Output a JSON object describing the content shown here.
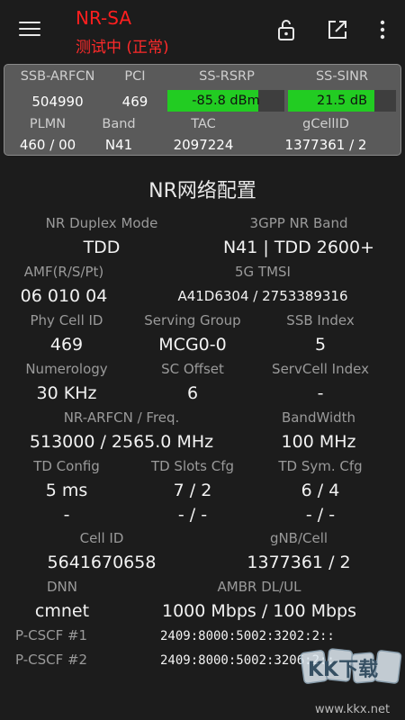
{
  "header": {
    "title": "NR-SA",
    "subtitle": "测试中 (正常)"
  },
  "panel": {
    "row1_labels": [
      "SSB-ARFCN",
      "PCI",
      "SS-RSRP",
      "SS-SINR"
    ],
    "ssb_arfcn": "504990",
    "pci": "469",
    "rsrp": {
      "text": "-85.8 dBm",
      "fill_fraction": 0.78,
      "color": "#22cc22"
    },
    "sinr": {
      "text": "21.5 dB",
      "fill_fraction": 0.8,
      "color": "#22cc22"
    },
    "row2_labels": [
      "PLMN",
      "Band",
      "TAC",
      "gCellID"
    ],
    "plmn": "460 / 00",
    "band": "N41",
    "tac": "2097224",
    "gcellid": "1377361 / 2"
  },
  "section_title": "NR网络配置",
  "config": {
    "duplex_label": "NR Duplex Mode",
    "duplex_value": "TDD",
    "band_label": "3GPP NR Band",
    "band_value": "N41 | TDD 2600+",
    "amf_label": "AMF(R/S/Pt)",
    "amf_value": "06 010 04",
    "tmsi_label": "5G TMSI",
    "tmsi_value": "A41D6304 / 2753389316",
    "phy_cell_label": "Phy Cell ID",
    "phy_cell_value": "469",
    "serving_group_label": "Serving Group",
    "serving_group_value": "MCG0-0",
    "ssb_index_label": "SSB Index",
    "ssb_index_value": "5",
    "numerology_label": "Numerology",
    "numerology_value": "30 KHz",
    "sc_offset_label": "SC Offset",
    "sc_offset_value": "6",
    "servcell_index_label": "ServCell Index",
    "servcell_index_value": "-",
    "arfcn_label": "NR-ARFCN / Freq.",
    "arfcn_value": "513000 / 2565.0 MHz",
    "bandwidth_label": "BandWidth",
    "bandwidth_value": "100 MHz",
    "td_config_label": "TD Config",
    "td_config_value": "5 ms",
    "td_config_value2": "-",
    "td_slots_label": "TD Slots Cfg",
    "td_slots_value": "7 / 2",
    "td_slots_value2": "- / -",
    "td_sym_label": "TD Sym. Cfg",
    "td_sym_value": "6 / 4",
    "td_sym_value2": "- / -",
    "cell_id_label": "Cell ID",
    "cell_id_value": "5641670658",
    "gnb_label": "gNB/Cell",
    "gnb_value": "1377361 / 2",
    "dnn_label": "DNN",
    "dnn_value": "cmnet",
    "ambr_label": "AMBR DL/UL",
    "ambr_value": "1000 Mbps / 100 Mbps",
    "pcscf1_label": "P-CSCF #1",
    "pcscf1_value": "2409:8000:5002:3202:2::",
    "pcscf2_label": "P-CSCF #2",
    "pcscf2_value": "2409:8000:5002:3206:2::"
  },
  "watermark": {
    "logo_text": "KK下载",
    "url": "www.kkx.net"
  }
}
